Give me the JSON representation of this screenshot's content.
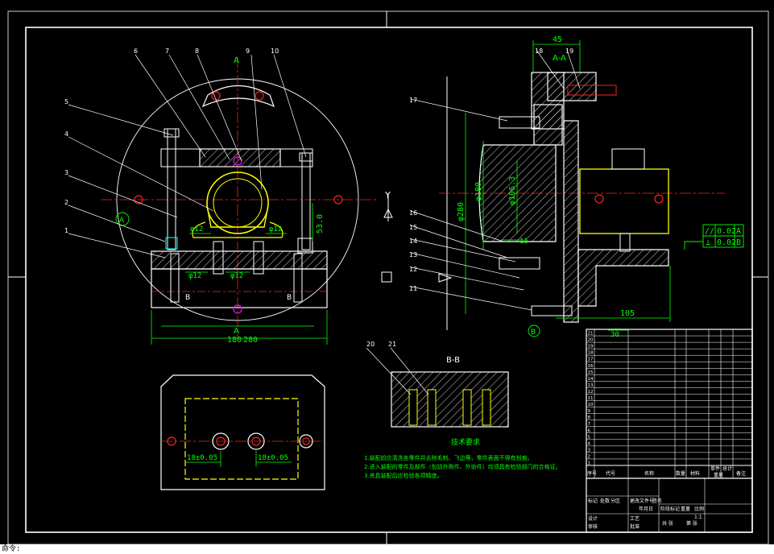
{
  "colors": {
    "background": "#000000",
    "frame": "#ffffff",
    "part": "#ffffff",
    "hatch": "#ffffff",
    "dimension": "#00ff00",
    "centerline": "#ff2020",
    "yellow_part": "#ffff00",
    "cyan": "#00ffff",
    "magenta": "#ff00ff",
    "note_text": "#00ff00"
  },
  "balloons": [
    "1",
    "2",
    "3",
    "4",
    "5",
    "6",
    "7",
    "8",
    "9",
    "10",
    "11",
    "12",
    "13",
    "14",
    "15",
    "16",
    "17",
    "18",
    "19",
    "20",
    "21"
  ],
  "section_labels": {
    "a_top": "A",
    "a_bottom": "A",
    "aa": "A-A",
    "bb": "B-B",
    "b_left": "B",
    "b_right": "B"
  },
  "callout_letters": {
    "a_circle": "A",
    "b_circle": "B",
    "y_axis": "Y"
  },
  "dimensions": {
    "width_top": "45",
    "width_bottom": "105",
    "base_width": "180",
    "base_width2": "280",
    "dia_280": "φ280",
    "dia_180": "φ180",
    "dia_106": "φ106.3",
    "dim_30": "30",
    "dim_16": "16",
    "height_53": "53.0",
    "dia_12_left": "φ12",
    "dia_12_right": "φ12",
    "dia_12_lower": "φ12",
    "dia_12_lower2": "φ12",
    "pitch_left": "18±0.05",
    "pitch_right": "18±0.05"
  },
  "tolerance_frames": [
    {
      "symbol": "//",
      "value": "0.02",
      "datum": "A"
    },
    {
      "symbol": "⊥",
      "value": "0.02",
      "datum": "B"
    }
  ],
  "tech_req": {
    "title": "技术要求",
    "lines": [
      "1.装配前应清洗各零件并去除毛刺、飞边等，零件表面不得有划痕。",
      "2.进入装配的零件及部件（包括外购件、外协件）均须具有检验部门的合格证。",
      "3.夹具装配后应检验各项精度。"
    ]
  },
  "title_block": {
    "header": [
      "序号",
      "代号",
      "名称",
      "数量",
      "材料",
      "单件",
      "总计",
      "备注"
    ],
    "mass_label": "重量",
    "row_numbers": [
      "21",
      "20",
      "19",
      "18",
      "17",
      "16",
      "15",
      "14",
      "13",
      "12",
      "11",
      "10",
      "9",
      "8",
      "7",
      "6",
      "5",
      "4",
      "3",
      "2",
      "1"
    ],
    "scale": "1:1",
    "bottom_labels": [
      "标记",
      "处数",
      "分区",
      "更改文件号",
      "签名",
      "年月日",
      "阶段标记",
      "重量",
      "比例",
      "设计",
      "审核",
      "工艺",
      "批准",
      "共 张",
      "第 张"
    ]
  },
  "command_line": "命令:"
}
